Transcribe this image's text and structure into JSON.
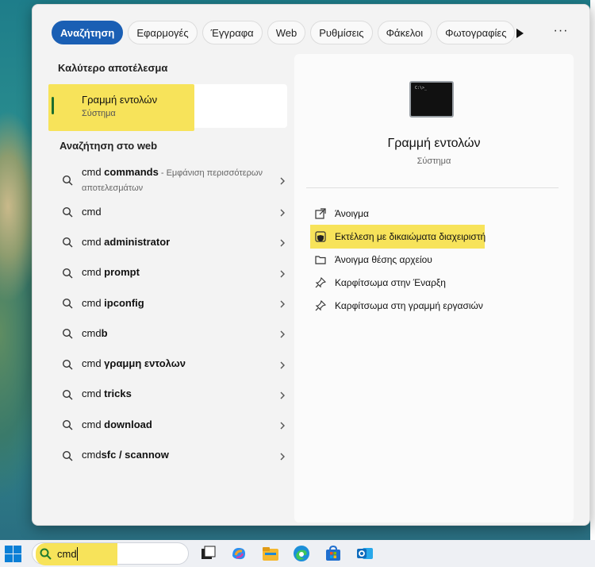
{
  "filters": [
    {
      "label": "Αναζήτηση",
      "active": true
    },
    {
      "label": "Εφαρμογές"
    },
    {
      "label": "Έγγραφα"
    },
    {
      "label": "Web"
    },
    {
      "label": "Ρυθμίσεις"
    },
    {
      "label": "Φάκελοι"
    },
    {
      "label": "Φωτογραφίες"
    }
  ],
  "more_label": "···",
  "best_match": {
    "heading": "Καλύτερο αποτέλεσμα",
    "title": "Γραμμή εντολών",
    "subtitle": "Σύστημα"
  },
  "web": {
    "heading": "Αναζήτηση στο web",
    "items": [
      {
        "prefix": "cmd ",
        "bold": "commands",
        "hint": " - Εμφάνιση περισσότερων αποτελεσμάτων"
      },
      {
        "prefix": "cmd",
        "bold": "",
        "hint": ""
      },
      {
        "prefix": "cmd ",
        "bold": "administrator",
        "hint": ""
      },
      {
        "prefix": "cmd ",
        "bold": "prompt",
        "hint": ""
      },
      {
        "prefix": "cmd ",
        "bold": "ipconfig",
        "hint": ""
      },
      {
        "prefix": "cmd",
        "bold": "b",
        "hint": ""
      },
      {
        "prefix": "cmd ",
        "bold": "γραμμη εντολων",
        "hint": ""
      },
      {
        "prefix": "cmd ",
        "bold": "tricks",
        "hint": ""
      },
      {
        "prefix": "cmd ",
        "bold": "download",
        "hint": ""
      },
      {
        "prefix": "cmd",
        "bold": "sfc / scannow",
        "hint": ""
      }
    ]
  },
  "detail": {
    "icon_text": "C:\\>_",
    "app_name": "Γραμμή εντολών",
    "app_type": "Σύστημα",
    "actions": [
      {
        "label": "Άνοιγμα",
        "icon": "open-external-icon"
      },
      {
        "label": "Εκτέλεση με δικαιώματα διαχειριστή",
        "icon": "admin-shield-icon",
        "highlight": true
      },
      {
        "label": "Άνοιγμα θέσης αρχείου",
        "icon": "folder-icon"
      },
      {
        "label": "Καρφίτσωμα στην Έναρξη",
        "icon": "pin-icon"
      },
      {
        "label": "Καρφίτσωμα στη γραμμή εργασιών",
        "icon": "pin-icon"
      }
    ]
  },
  "taskbar": {
    "search_value": "cmd",
    "apps": [
      "task-view-icon",
      "copilot-icon",
      "file-explorer-icon",
      "edge-icon",
      "store-icon",
      "outlook-icon"
    ]
  },
  "colors": {
    "accent": "#1a5fb4",
    "highlight": "#f7e35a"
  }
}
